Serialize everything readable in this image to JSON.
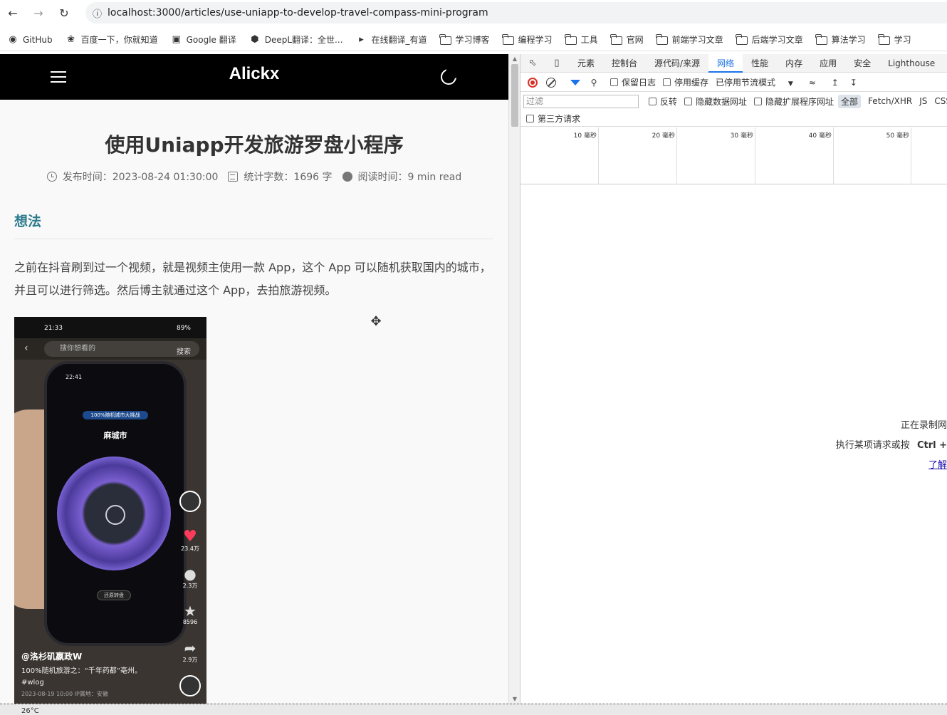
{
  "browser": {
    "url": "localhost:3000/articles/use-uniapp-to-develop-travel-compass-mini-program",
    "bookmarks": [
      {
        "label": "GitHub",
        "icon": "github-icon"
      },
      {
        "label": "百度一下，你就知道",
        "icon": "baidu-icon"
      },
      {
        "label": "Google 翻译",
        "icon": "google-translate-icon"
      },
      {
        "label": "DeepL翻译：全世...",
        "icon": "deepl-icon"
      },
      {
        "label": "在线翻译_有道",
        "icon": "youdao-icon"
      },
      {
        "label": "学习博客",
        "icon": "folder-icon"
      },
      {
        "label": "编程学习",
        "icon": "folder-icon"
      },
      {
        "label": "工具",
        "icon": "folder-icon"
      },
      {
        "label": "官网",
        "icon": "folder-icon"
      },
      {
        "label": "前端学习文章",
        "icon": "folder-icon"
      },
      {
        "label": "后端学习文章",
        "icon": "folder-icon"
      },
      {
        "label": "算法学习",
        "icon": "folder-icon"
      },
      {
        "label": "学习",
        "icon": "folder-icon"
      }
    ]
  },
  "site": {
    "brand": "Alickx",
    "title": "使用Uniapp开发旅游罗盘小程序",
    "meta": {
      "published": "发布时间：2023-08-24 01:30:00",
      "wordcount": "统计字数：1696 字",
      "readtime": "阅读时间：9 min read"
    },
    "section_heading": "想法",
    "paragraph": "之前在抖音刷到过一个视频，就是视频主使用一款 App，这个 App 可以随机获取国内的城市，并且可以进行筛选。然后博主就通过这个 App，去拍旅游视频。",
    "screenshot": {
      "status_time": "21:33",
      "battery": "89%",
      "search_placeholder": "搜你想看的",
      "search_button": "搜索",
      "device_time": "22:41",
      "banner": "100%随机城市大挑战",
      "city": "麻城市",
      "rotate_button": "还原转盘",
      "likes": "23.4万",
      "comments": "2.3万",
      "favorites": "8596",
      "shares": "2.9万",
      "author": "@洛杉矶嬴政W",
      "description": "100%随机旅游之：“千年药都”亳州。",
      "hashtag": "#wlog",
      "date": "2023-08-19 10:00 IP属地：安徽"
    }
  },
  "devtools": {
    "tabs": [
      "元素",
      "控制台",
      "源代码/来源",
      "网络",
      "性能",
      "内存",
      "应用",
      "安全",
      "Lighthouse"
    ],
    "active_tab": "网络",
    "toolbar": {
      "preserve_log": "保留日志",
      "disable_cache": "停用缓存",
      "throttling": "已停用节流模式"
    },
    "filter": {
      "placeholder": "过滤",
      "invert": "反转",
      "hide_data_urls": "隐藏数据网址",
      "hide_extension_urls": "隐藏扩展程序网址",
      "all": "全部",
      "types": [
        "Fetch/XHR",
        "JS",
        "CSS"
      ]
    },
    "third_party": "第三方请求",
    "timeline_labels": [
      "10 毫秒",
      "20 毫秒",
      "30 毫秒",
      "40 毫秒",
      "50 毫秒"
    ],
    "empty": {
      "line1": "正在录制网",
      "line2_prefix": "执行某项请求或按",
      "line2_key": "Ctrl +",
      "link": "了解"
    }
  },
  "taskbar": {
    "weather": "26°C"
  }
}
